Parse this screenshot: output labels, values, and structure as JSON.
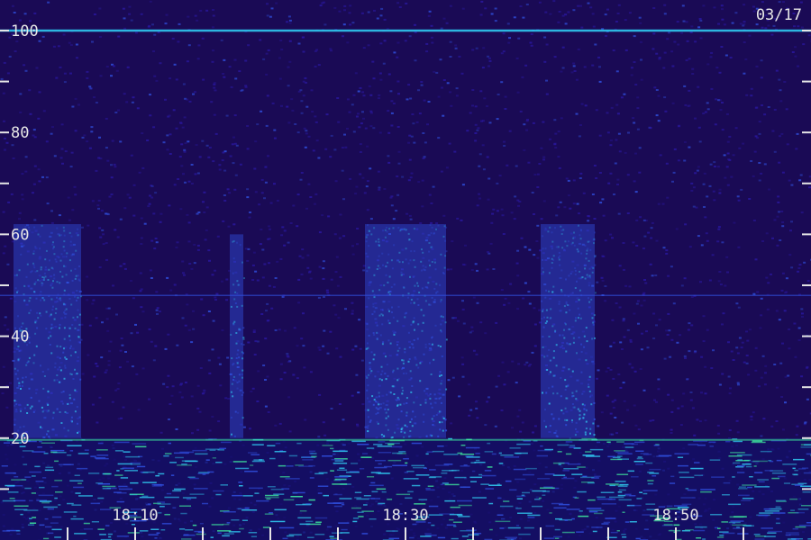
{
  "chart_data": {
    "type": "heatmap",
    "date_label": "03/17",
    "y_ticks": [
      {
        "value": 100,
        "label": "100"
      },
      {
        "value": 90,
        "label": ""
      },
      {
        "value": 80,
        "label": "80"
      },
      {
        "value": 70,
        "label": ""
      },
      {
        "value": 60,
        "label": "60"
      },
      {
        "value": 50,
        "label": ""
      },
      {
        "value": 40,
        "label": "40"
      },
      {
        "value": 30,
        "label": ""
      },
      {
        "value": 20,
        "label": "20"
      },
      {
        "value": 10,
        "label": ""
      }
    ],
    "ylim": [
      0,
      106
    ],
    "x_ticks": [
      {
        "value": "18:05",
        "label": ""
      },
      {
        "value": "18:10",
        "label": "18:10"
      },
      {
        "value": "18:15",
        "label": ""
      },
      {
        "value": "18:20",
        "label": ""
      },
      {
        "value": "18:25",
        "label": ""
      },
      {
        "value": "18:30",
        "label": "18:30"
      },
      {
        "value": "18:35",
        "label": ""
      },
      {
        "value": "18:40",
        "label": ""
      },
      {
        "value": "18:45",
        "label": ""
      },
      {
        "value": "18:50",
        "label": "18:50"
      },
      {
        "value": "18:55",
        "label": ""
      }
    ],
    "xlim": [
      "18:00",
      "19:00"
    ],
    "colors": {
      "background": "#1a0a55",
      "low": "#2a18a0",
      "mid": "#3050e0",
      "high": "#30c8f0",
      "peak": "#40f0a0",
      "text": "#e6e6e6"
    },
    "bright_bands": [
      {
        "start": "18:01",
        "end": "18:06",
        "fmin": 20,
        "fmax": 62
      },
      {
        "start": "18:17",
        "end": "18:18",
        "fmin": 20,
        "fmax": 60
      },
      {
        "start": "18:27",
        "end": "18:33",
        "fmin": 20,
        "fmax": 62
      },
      {
        "start": "18:40",
        "end": "18:44",
        "fmin": 20,
        "fmax": 62
      }
    ],
    "tones": [
      {
        "frequency": 100,
        "level": "high"
      },
      {
        "frequency": 48,
        "level": "mid"
      }
    ]
  }
}
